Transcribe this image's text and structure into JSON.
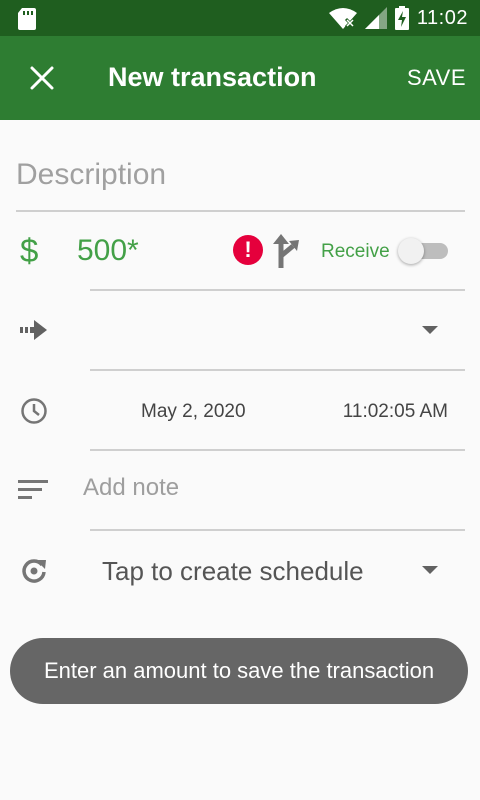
{
  "status_bar": {
    "time": "11:02"
  },
  "app_bar": {
    "title": "New transaction",
    "save_label": "SAVE",
    "close_icon": "close-icon"
  },
  "form": {
    "description_placeholder": "Description",
    "description_value": "",
    "currency_symbol": "$",
    "amount": "500*",
    "error_glyph": "!",
    "receive_label": "Receive",
    "receive_enabled": false,
    "transfer_account": "",
    "date": "May 2, 2020",
    "time": "11:02:05 AM",
    "note_placeholder": "Add note",
    "schedule_label": "Tap to create schedule"
  },
  "toast": {
    "message": "Enter an amount to save the transaction"
  },
  "colors": {
    "status_bar": "#1f5e1f",
    "app_bar": "#2e7d32",
    "accent": "#43a047",
    "error": "#e5003c",
    "toast": "#666666"
  }
}
